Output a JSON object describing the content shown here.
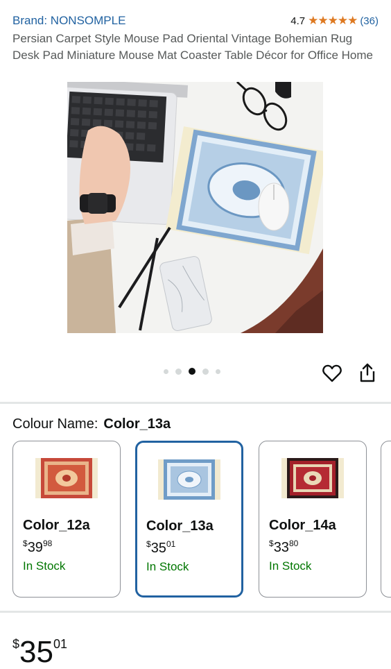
{
  "brand": {
    "link_text": "Brand: NONSOMPLE"
  },
  "rating": {
    "value": "4.7",
    "stars": "★★★★★",
    "count": "(36)"
  },
  "product": {
    "title": "Persian Carpet Style Mouse Pad Oriental Vintage Bohemian Rug Desk Pad Miniature Mouse Mat Coaster Table Décor for Office Home"
  },
  "carousel": {
    "total": 5,
    "active": 3
  },
  "actions": {
    "wishlist_icon": "heart-icon",
    "share_icon": "share-icon"
  },
  "variation": {
    "label": "Colour Name:",
    "selected": "Color_13a",
    "options": [
      {
        "name": "Color_12a",
        "price_symbol": "$",
        "price_whole": "39",
        "price_fraction": "98",
        "stock": "In Stock",
        "accent": "#c7493a"
      },
      {
        "name": "Color_13a",
        "price_symbol": "$",
        "price_whole": "35",
        "price_fraction": "01",
        "stock": "In Stock",
        "accent": "#6f9cc7"
      },
      {
        "name": "Color_14a",
        "price_symbol": "$",
        "price_whole": "33",
        "price_fraction": "80",
        "stock": "In Stock",
        "accent": "#a3202a"
      }
    ]
  },
  "price": {
    "symbol": "$",
    "whole": "35",
    "fraction": "01"
  },
  "colors": {
    "link": "#2162a1",
    "star": "#de7921",
    "in_stock": "#007600",
    "selected_border": "#2162a1"
  }
}
